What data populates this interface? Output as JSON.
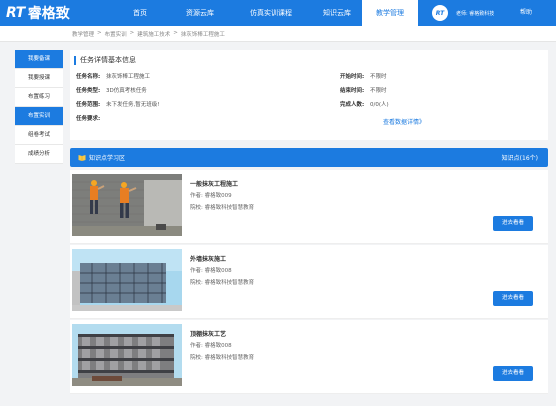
{
  "logo": {
    "mark": "RT",
    "name": "睿格致"
  },
  "nav": {
    "items": [
      {
        "label": "首页",
        "active": false
      },
      {
        "label": "资源云库",
        "active": false
      },
      {
        "label": "仿真实训课程",
        "active": false
      },
      {
        "label": "知识云库",
        "active": false
      },
      {
        "label": "教学管理",
        "active": true
      }
    ],
    "avatar_text": "RT",
    "user_text": "老师: 睿格致科技",
    "help": "帮助"
  },
  "breadcrumb": [
    "教学管理",
    "布置实训",
    "建筑施工技术",
    "抹灰饰棒工程施工"
  ],
  "sidebar": {
    "items": [
      {
        "label": "我要备课",
        "state": "header"
      },
      {
        "label": "我要授课",
        "state": "normal"
      },
      {
        "label": "布置练习",
        "state": "normal"
      },
      {
        "label": "布置实训",
        "state": "active"
      },
      {
        "label": "组卷考试",
        "state": "normal"
      },
      {
        "label": "成绩分析",
        "state": "normal"
      }
    ]
  },
  "task_info": {
    "title": "任务详情基本信息",
    "left": [
      {
        "label": "任务名称:",
        "value": "抹灰饰棒工程施工"
      },
      {
        "label": "任务类型:",
        "value": "3D仿真考核任务"
      },
      {
        "label": "任务范围:",
        "value": "未下发任务,暂无班级!"
      },
      {
        "label": "任务要求:",
        "value": ""
      }
    ],
    "right": [
      {
        "label": "开始时间:",
        "value": "不限时"
      },
      {
        "label": "结束时间:",
        "value": "不限时"
      },
      {
        "label": "完成人数:",
        "value": "0/0(人)"
      }
    ],
    "detail_link": "查看数据详情》"
  },
  "knowledge": {
    "title": "知识点学习区",
    "count": "知识点(16个)",
    "cards": [
      {
        "title": "一般抹灰工程施工",
        "author": "作者: 睿格致009",
        "school": "院校: 睿格致科技智慧教育",
        "button": "进去看看",
        "thumb": "plaster-workers"
      },
      {
        "title": "外墙抹灰施工",
        "author": "作者: 睿格致008",
        "school": "院校: 睿格致科技智慧教育",
        "button": "进去看看",
        "thumb": "wall-grid"
      },
      {
        "title": "顶棚抹灰工艺",
        "author": "作者: 睿格致008",
        "school": "院校: 睿格致科技智慧教育",
        "button": "进去看看",
        "thumb": "building-frame"
      }
    ]
  },
  "colors": {
    "brand": "#1c7be0",
    "panel": "#ffffff",
    "background": "#f2f3f5"
  }
}
